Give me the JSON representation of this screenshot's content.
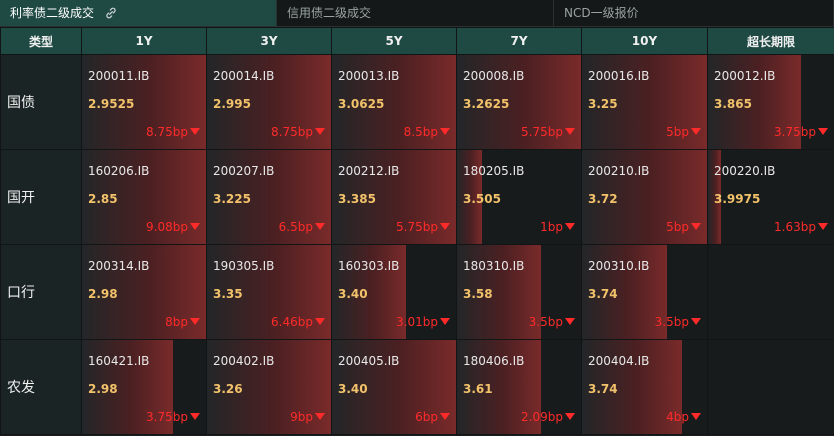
{
  "tabs": [
    {
      "label": "利率债二级成交",
      "active": true
    },
    {
      "label": "信用债二级成交",
      "active": false
    },
    {
      "label": "NCD一级报价",
      "active": false
    }
  ],
  "table": {
    "header": [
      "类型",
      "1Y",
      "3Y",
      "5Y",
      "7Y",
      "10Y",
      "超长期限"
    ],
    "rows": [
      {
        "label": "国债",
        "cells": [
          {
            "code": "200011.IB",
            "rate": "2.9525",
            "change": "8.75bp",
            "level": 1.0
          },
          {
            "code": "200014.IB",
            "rate": "2.995",
            "change": "8.75bp",
            "level": 1.0
          },
          {
            "code": "200013.IB",
            "rate": "3.0625",
            "change": "8.5bp",
            "level": 1.0
          },
          {
            "code": "200008.IB",
            "rate": "3.2625",
            "change": "5.75bp",
            "level": 1.0
          },
          {
            "code": "200016.IB",
            "rate": "3.25",
            "change": "5bp",
            "level": 1.0
          },
          {
            "code": "200012.IB",
            "rate": "3.865",
            "change": "3.75bp",
            "level": 0.74
          }
        ]
      },
      {
        "label": "国开",
        "cells": [
          {
            "code": "160206.IB",
            "rate": "2.85",
            "change": "9.08bp",
            "level": 1.0
          },
          {
            "code": "200207.IB",
            "rate": "3.225",
            "change": "6.5bp",
            "level": 1.0
          },
          {
            "code": "200212.IB",
            "rate": "3.385",
            "change": "5.75bp",
            "level": 1.0
          },
          {
            "code": "180205.IB",
            "rate": "3.505",
            "change": "1bp",
            "level": 0.2
          },
          {
            "code": "200210.IB",
            "rate": "3.72",
            "change": "5bp",
            "level": 1.0
          },
          {
            "code": "200220.IB",
            "rate": "3.9975",
            "change": "1.63bp",
            "level": 0.1
          }
        ]
      },
      {
        "label": "口行",
        "cells": [
          {
            "code": "200314.IB",
            "rate": "2.98",
            "change": "8bp",
            "level": 1.0
          },
          {
            "code": "190305.IB",
            "rate": "3.35",
            "change": "6.46bp",
            "level": 1.0
          },
          {
            "code": "160303.IB",
            "rate": "3.40",
            "change": "3.01bp",
            "level": 0.6
          },
          {
            "code": "180310.IB",
            "rate": "3.58",
            "change": "3.5bp",
            "level": 0.68
          },
          {
            "code": "200310.IB",
            "rate": "3.74",
            "change": "3.5bp",
            "level": 0.68
          },
          null
        ]
      },
      {
        "label": "农发",
        "cells": [
          {
            "code": "160421.IB",
            "rate": "2.98",
            "change": "3.75bp",
            "level": 0.73
          },
          {
            "code": "200402.IB",
            "rate": "3.26",
            "change": "9bp",
            "level": 1.0
          },
          {
            "code": "200405.IB",
            "rate": "3.40",
            "change": "6bp",
            "level": 1.0
          },
          {
            "code": "180406.IB",
            "rate": "3.61",
            "change": "2.09bp",
            "level": 0.68
          },
          {
            "code": "200404.IB",
            "rate": "3.74",
            "change": "4bp",
            "level": 0.8
          },
          null
        ]
      }
    ]
  },
  "colors": {
    "accent": "#1f4a44",
    "rate": "#f2c26b",
    "down": "#ff2a2a",
    "bar_end": "#7a2a2a"
  }
}
